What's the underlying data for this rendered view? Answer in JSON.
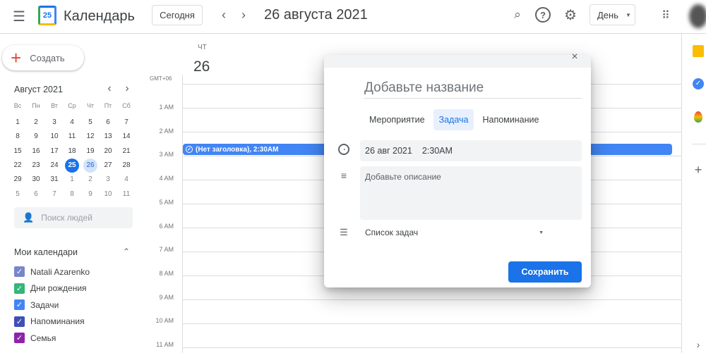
{
  "header": {
    "app_title": "Календарь",
    "logo_day": "25",
    "today_button": "Сегодня",
    "date_title": "26 августа 2021",
    "view_select": "День"
  },
  "sidebar": {
    "create_button": "Создать",
    "mini_calendar": {
      "month": "Август 2021",
      "weekdays": [
        "Вс",
        "Пн",
        "Вт",
        "Ср",
        "Чт",
        "Пт",
        "Сб"
      ],
      "weeks": [
        [
          "1",
          "2",
          "3",
          "4",
          "5",
          "6",
          "7"
        ],
        [
          "8",
          "9",
          "10",
          "11",
          "12",
          "13",
          "14"
        ],
        [
          "15",
          "16",
          "17",
          "18",
          "19",
          "20",
          "21"
        ],
        [
          "22",
          "23",
          "24",
          "25",
          "26",
          "27",
          "28"
        ],
        [
          "29",
          "30",
          "31",
          "1",
          "2",
          "3",
          "4"
        ],
        [
          "5",
          "6",
          "7",
          "8",
          "9",
          "10",
          "11"
        ]
      ]
    },
    "search_people_placeholder": "Поиск людей",
    "my_calendars_title": "Мои календари",
    "calendars": [
      {
        "name": "Natali Azarenko",
        "color": "#7986cb"
      },
      {
        "name": "Дни рождения",
        "color": "#33b679"
      },
      {
        "name": "Задачи",
        "color": "#4285f4"
      },
      {
        "name": "Напоминания",
        "color": "#3f51b5"
      },
      {
        "name": "Семья",
        "color": "#8e24aa"
      }
    ]
  },
  "day_view": {
    "weekday": "ЧТ",
    "day": "26",
    "timezone": "GMT+06",
    "hours": [
      "1 AM",
      "2 AM",
      "3 AM",
      "4 AM",
      "5 AM",
      "6 AM",
      "7 AM",
      "8 AM",
      "9 AM",
      "10 AM",
      "11 AM"
    ],
    "event": "(Нет заголовка), 2:30AM"
  },
  "dialog": {
    "title_placeholder": "Добавьте название",
    "tabs": [
      "Мероприятие",
      "Задача",
      "Напоминание"
    ],
    "active_tab": "Задача",
    "date": "26 авг 2021",
    "time": "2:30AM",
    "description_placeholder": "Добавьте описание",
    "task_list": "Список задач",
    "save_button": "Сохранить"
  }
}
